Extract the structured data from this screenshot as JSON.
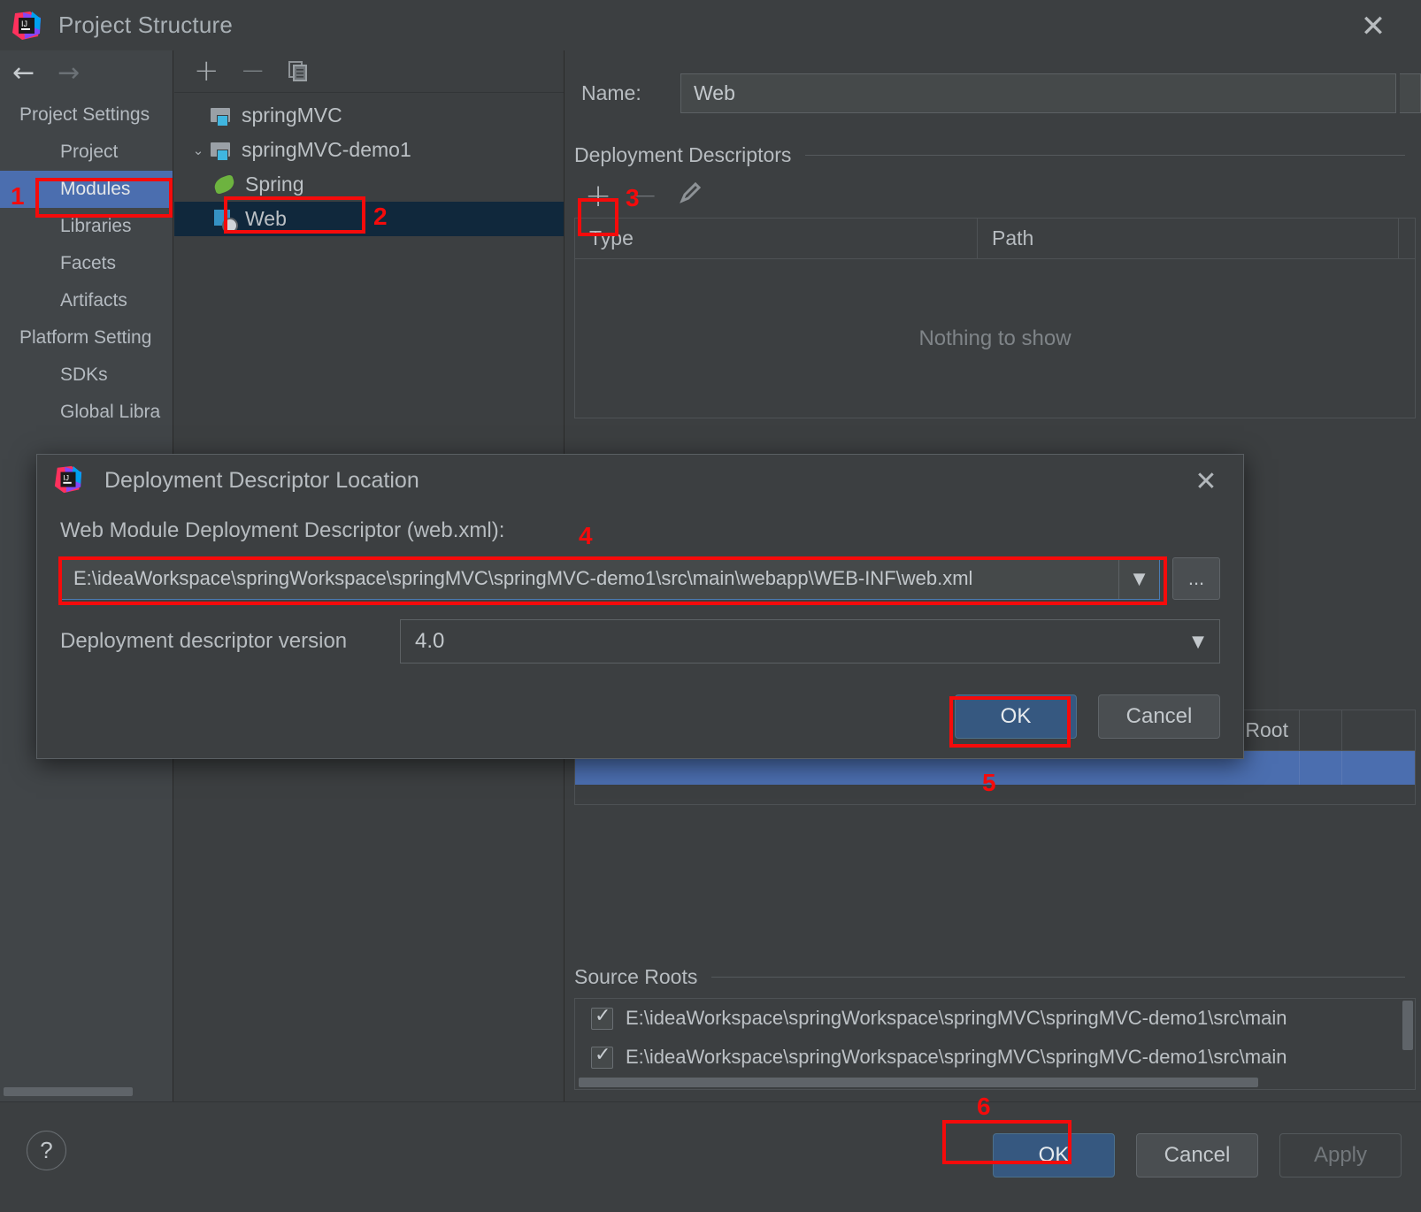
{
  "window": {
    "title": "Project Structure",
    "logo_icon": "intellij-idea-logo-icon",
    "close_icon": "close-icon"
  },
  "sidebar": {
    "back_icon": "arrow-left-icon",
    "forward_icon": "arrow-right-icon",
    "groups": [
      {
        "label": "Project Settings",
        "items": [
          {
            "label": "Project",
            "selected": false
          },
          {
            "label": "Modules",
            "selected": true
          },
          {
            "label": "Libraries",
            "selected": false
          },
          {
            "label": "Facets",
            "selected": false
          },
          {
            "label": "Artifacts",
            "selected": false
          }
        ]
      },
      {
        "label": "Platform Setting",
        "items": [
          {
            "label": "SDKs",
            "selected": false
          },
          {
            "label": "Global Libra",
            "selected": false
          }
        ]
      }
    ]
  },
  "tree": {
    "toolbar": {
      "add_icon": "plus-icon",
      "remove_icon": "minus-icon",
      "copy_icon": "copy-icon"
    },
    "nodes": [
      {
        "label": "springMVC",
        "depth": 0,
        "icon": "module-folder-icon",
        "expander": "",
        "selected": false
      },
      {
        "label": "springMVC-demo1",
        "depth": 0,
        "icon": "module-folder-icon",
        "expander": "⌄",
        "selected": false
      },
      {
        "label": "Spring",
        "depth": 1,
        "icon": "spring-leaf-icon",
        "expander": "",
        "selected": false
      },
      {
        "label": "Web",
        "depth": 1,
        "icon": "web-facet-icon",
        "expander": "",
        "selected": true
      }
    ]
  },
  "detail": {
    "name_label": "Name:",
    "name_value": "Web",
    "deployment_descriptors": {
      "section_title": "Deployment Descriptors",
      "add_icon": "plus-icon",
      "remove_icon": "minus-icon",
      "edit_icon": "pencil-icon",
      "columns": [
        "Type",
        "Path"
      ],
      "empty_text": "Nothing to show"
    },
    "resource_table": {
      "header_partial": "ent Root"
    },
    "source_roots": {
      "section_title": "Source Roots",
      "items": [
        {
          "checked": true,
          "path": "E:\\ideaWorkspace\\springWorkspace\\springMVC\\springMVC-demo1\\src\\main"
        },
        {
          "checked": true,
          "path": "E:\\ideaWorkspace\\springWorkspace\\springMVC\\springMVC-demo1\\src\\main"
        }
      ]
    }
  },
  "footer": {
    "help_icon": "help-question-icon",
    "ok_label": "OK",
    "cancel_label": "Cancel",
    "apply_label": "Apply"
  },
  "modal": {
    "logo_icon": "intellij-idea-logo-icon",
    "title": "Deployment Descriptor Location",
    "close_icon": "close-icon",
    "field_label": "Web Module Deployment Descriptor (web.xml):",
    "path_value": "E:\\ideaWorkspace\\springWorkspace\\springMVC\\springMVC-demo1\\src\\main\\webapp\\WEB-INF\\web.xml",
    "path_dropdown_icon": "chevron-down-icon",
    "browse_label": "...",
    "version_label": "Deployment descriptor version",
    "version_value": "4.0",
    "version_dropdown_icon": "chevron-down-icon",
    "ok_label": "OK",
    "cancel_label": "Cancel"
  },
  "annotations": {
    "color": "#f50b0b",
    "steps": [
      "1",
      "2",
      "3",
      "4",
      "5",
      "6"
    ]
  }
}
